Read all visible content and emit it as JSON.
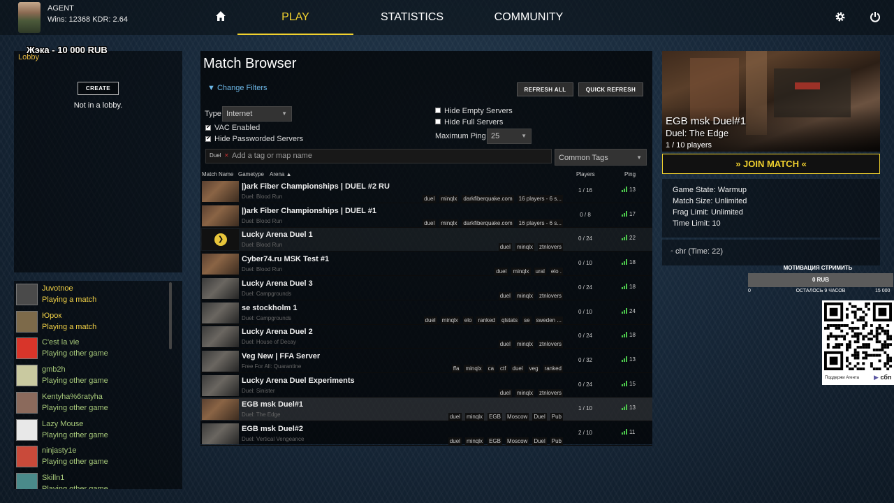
{
  "topbar": {
    "player_name": "AGENT",
    "player_stats": "Wins: 12368 KDR: 2.64",
    "nav": [
      "PLAY",
      "STATISTICS",
      "COMMUNITY"
    ],
    "icons": [
      "home-icon",
      "settings-gear-icon",
      "power-icon"
    ]
  },
  "overlay": {
    "donation": "Жэка - 10 000 RUB"
  },
  "lobby": {
    "title": "Lobby",
    "create_label": "CREATE",
    "status": "Not in a lobby."
  },
  "friends": [
    {
      "name": "Juvotnoe",
      "status": "Playing a match",
      "kind": "ingame",
      "color": "#4a4a4a"
    },
    {
      "name": "Юрок",
      "status": "Playing a match",
      "kind": "ingame",
      "color": "#7d6a4a"
    },
    {
      "name": "C'est la vie",
      "status": "Playing other game",
      "kind": "other",
      "color": "#d8352a"
    },
    {
      "name": "gmb2h",
      "status": "Playing other game",
      "kind": "other",
      "color": "#c9c9a0"
    },
    {
      "name": "Kentyha%6ratyha",
      "status": "Playing other game",
      "kind": "other",
      "color": "#8b6a5c"
    },
    {
      "name": "Lazy Mouse",
      "status": "Playing other game",
      "kind": "other",
      "color": "#e8e8e8"
    },
    {
      "name": "ninjasty1e",
      "status": "Playing other game",
      "kind": "other",
      "color": "#c94a3a"
    },
    {
      "name": "Skilln1",
      "status": "Playing other game",
      "kind": "other",
      "color": "#4a8a8a"
    }
  ],
  "browser": {
    "title": "Match Browser",
    "change_filters": "Change Filters",
    "refresh_all": "REFRESH ALL",
    "quick_refresh": "QUICK REFRESH",
    "type_label": "Type",
    "type_value": "Internet",
    "vac_label": "VAC Enabled",
    "hide_passworded_label": "Hide Passworded Servers",
    "hide_empty_label": "Hide Empty Servers",
    "hide_full_label": "Hide Full Servers",
    "max_ping_label": "Maximum Ping",
    "max_ping_value": "25",
    "tag_chip": "Duel",
    "tag_placeholder": "Add a tag or map name",
    "common_tags": "Common Tags",
    "col_match_name": "Match Name",
    "col_gametype": "Gametype",
    "col_arena": "Arena",
    "col_players": "Players",
    "col_ping": "Ping",
    "rows": [
      {
        "name": "|)ark Fiber Championships | DUEL #2 RU",
        "sub": "Duel: Blood Run",
        "tags": [
          "duel",
          "minqlx",
          "darkfiberquake.com",
          "16 players - 6 s..."
        ],
        "players": "1 / 16",
        "ping": "13",
        "thumb": "brown"
      },
      {
        "name": "|)ark Fiber Championships | DUEL #1",
        "sub": "Duel: Blood Run",
        "tags": [
          "duel",
          "minqlx",
          "darkfiberquake.com",
          "16 players - 6 s..."
        ],
        "players": "0 / 8",
        "ping": "17",
        "thumb": "brown"
      },
      {
        "name": "Lucky Arena Duel 1",
        "sub": "Duel: Blood Run",
        "tags": [
          "duel",
          "minqlx",
          "ztnlovers"
        ],
        "players": "0 / 24",
        "ping": "22",
        "thumb": "play"
      },
      {
        "name": "Cyber74.ru MSK Test #1",
        "sub": "Duel: Blood Run",
        "tags": [
          "duel",
          "minqlx",
          "ural",
          "elo ."
        ],
        "players": "0 / 10",
        "ping": "18",
        "thumb": "brown"
      },
      {
        "name": "Lucky Arena Duel 3",
        "sub": "Duel: Campgrounds",
        "tags": [
          "duel",
          "minqlx",
          "ztnlovers"
        ],
        "players": "0 / 24",
        "ping": "18",
        "thumb": "gray"
      },
      {
        "name": "se stockholm 1",
        "sub": "Duel: Campgrounds",
        "tags": [
          "duel",
          "minqlx",
          "elo",
          "ranked",
          "qlstats",
          "se",
          "sweden ..."
        ],
        "players": "0 / 10",
        "ping": "24",
        "thumb": "gray"
      },
      {
        "name": "Lucky Arena Duel 2",
        "sub": "Duel: House of Decay",
        "tags": [
          "duel",
          "minqlx",
          "ztnlovers"
        ],
        "players": "0 / 24",
        "ping": "18",
        "thumb": "gray"
      },
      {
        "name": "Veg New | FFA Server",
        "sub": "Free For All: Quarantine",
        "tags": [
          "ffa",
          "minqlx",
          "ca",
          "ctf",
          "duel",
          "veg",
          "ranked"
        ],
        "players": "0 / 32",
        "ping": "13",
        "thumb": "gray"
      },
      {
        "name": "Lucky Arena Duel Experiments",
        "sub": "Duel: Sinister",
        "tags": [
          "duel",
          "minqlx",
          "ztnlovers"
        ],
        "players": "0 / 24",
        "ping": "15",
        "thumb": "gray"
      },
      {
        "name": "EGB msk Duel#1",
        "sub": "Duel: The Edge",
        "tags": [
          "duel",
          "minqlx",
          "EGB",
          "Moscow",
          "Duel",
          "Pub"
        ],
        "players": "1 / 10",
        "ping": "13",
        "thumb": "brown"
      },
      {
        "name": "EGB msk Duel#2",
        "sub": "Duel: Vertical Vengeance",
        "tags": [
          "duel",
          "minqlx",
          "EGB",
          "Moscow",
          "Duel",
          "Pub"
        ],
        "players": "2 / 10",
        "ping": "11",
        "thumb": "gray"
      }
    ]
  },
  "detail": {
    "server_name": "EGB msk Duel#1",
    "map": "Duel: The Edge",
    "players": "1 / 10 players",
    "join_label": "» JOIN MATCH «",
    "game_state": "Game State: Warmup",
    "match_size": "Match Size: Unlimited",
    "frag_limit": "Frag Limit: Unlimited",
    "time_limit": "Time Limit: 10",
    "player_entry": "chr (Time: 22)"
  },
  "donation_widget": {
    "title": "МОТИВАЦИЯ СТРИМИТЬ",
    "value": "0 RUB",
    "min": "0",
    "remaining": "ОСТАЛОСЬ 9 ЧАСОВ",
    "max": "15 000",
    "progress": 0,
    "qr_caption": "Поддержи Агента",
    "sbp": "сбп"
  },
  "colors": {
    "accent": "#f2d22e",
    "link": "#6db8e8",
    "ping_green": "#4cc94c"
  }
}
